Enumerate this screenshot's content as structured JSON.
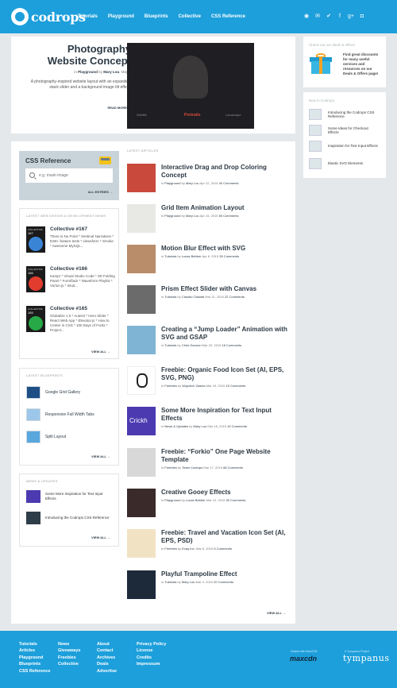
{
  "header": {
    "logo_text": "codrops",
    "nav": [
      "Tutorials",
      "Playground",
      "Blueprints",
      "Collective",
      "CSS Reference"
    ],
    "social_icons": [
      "rss-icon",
      "mail-icon",
      "twitter-icon",
      "facebook-icon",
      "google-plus-icon",
      "stumbleupon-icon"
    ],
    "social_glyphs": [
      "◉",
      "✉",
      "✔",
      "f",
      "g+",
      "◘"
    ]
  },
  "hero": {
    "title": "Photography Website Concept",
    "meta_in": "in",
    "meta_category": "Playground",
    "meta_by": "by",
    "meta_author": "Mary Lou",
    "meta_date": "May 6",
    "description": "A photography-inspired website layout with an expanding stack slider and a background image tilt effect.",
    "read_more": "READ MORE →",
    "image_labels": [
      "Wildlife",
      "Portraits",
      "Landscape"
    ]
  },
  "deals": {
    "heading": "Check out our deals & offers!",
    "text_prefix": "Find great discounts for many useful services and resources on our",
    "link": "Deals & Offers page!"
  },
  "new_in_codrops": {
    "heading": "New in Codrops",
    "items": [
      "Introducing the Codrops CSS Reference",
      "Some Ideas for Checkout Effects",
      "Inspiration for Text Input Effects",
      "Elastic SVG Elements"
    ]
  },
  "css_reference": {
    "title": "CSS Reference",
    "search_placeholder": "e.g. mask-image",
    "all_entries": "ALL ENTRIES →"
  },
  "collective": {
    "heading": "LATEST WEB DESIGN & DEVELOPMENT NEWS",
    "thumb_label": "COLLECTIVE",
    "items": [
      {
        "number": "167",
        "title": "Collective #167",
        "desc": "There is No Point * Sentinal Narratives * ES6+ feature tests * viewsform * Smoke * Awesome MySQL...",
        "color": "#3a84d6"
      },
      {
        "number": "166",
        "title": "Collective #166",
        "desc": "Kampr * Visual Studio Code * 3D Folding Panel * Formflack * Waveform Playlist * Vorlon.js * Intuit...",
        "color": "#e23c2f"
      },
      {
        "number": "165",
        "title": "Collective #165",
        "desc": "Globalize 1.0 * Auteist * Hero Slider * React Web App * Elevator.js * How to Center in CSS * 100 Days of Fonts * Project...",
        "color": "#27a947"
      }
    ],
    "view_all": "VIEW ALL →"
  },
  "blueprints": {
    "heading": "LATEST BLUEPRINTS",
    "items": [
      "Google Grid Gallery",
      "Responsive Full Width Tabs",
      "Split Layout"
    ],
    "view_all": "VIEW ALL →"
  },
  "news_updates": {
    "heading": "NEWS & UPDATES",
    "items": [
      "Some More Inspiration for Text Input Effects",
      "Introducing the Codrops CSS Reference"
    ],
    "view_all": "VIEW ALL →"
  },
  "articles": {
    "heading": "LATEST ARTICLES",
    "items": [
      {
        "title": "Interactive Drag and Drop Coloring Concept",
        "in": "in",
        "category": "Playground",
        "by": "by",
        "author": "Mary Lou",
        "date": "Apr 22, 2015",
        "comments": "40 Comments",
        "thumb_bg": "#c94a3c"
      },
      {
        "title": "Grid Item Animation Layout",
        "in": "in",
        "category": "Playground",
        "by": "by",
        "author": "Mary Lou",
        "date": "Apr 15, 2015",
        "comments": "50 Comments",
        "thumb_bg": "#e8e8e4"
      },
      {
        "title": "Motion Blur Effect with SVG",
        "in": "in",
        "category": "Tutorials",
        "by": "by",
        "author": "Lucas Bebber",
        "date": "Apr 8, 2015",
        "comments": "35 Comments",
        "thumb_bg": "#b98c6a"
      },
      {
        "title": "Prism Effect Slider with Canvas",
        "in": "in",
        "category": "Tutorials",
        "by": "by",
        "author": "Claudio Calautti",
        "date": "Mar 31, 2015",
        "comments": "22 Comments",
        "thumb_bg": "#6b6b6b"
      },
      {
        "title": "Creating a “Jump Loader” Animation with SVG and GSAP",
        "in": "in",
        "category": "Tutorials",
        "by": "by",
        "author": "Chris Gannon",
        "date": "Mar 25, 2015",
        "comments": "18 Comments",
        "thumb_bg": "#7fb4d4"
      },
      {
        "title": "Freebie: Organic Food Icon Set (AI, EPS, SVG, PNG)",
        "in": "in",
        "category": "Freebies",
        "by": "by",
        "author": "Wojciech Zasina",
        "date": "Mar 19, 2015",
        "comments": "15 Comments",
        "thumb_bg": "#ffffff"
      },
      {
        "title": "Some More Inspiration for Text Input Effects",
        "in": "in",
        "category": "News & Updates",
        "by": "by",
        "author": "Mary Lou",
        "date": "Mar 18, 2015",
        "comments": "19 Comments",
        "thumb_bg": "#4b3ab0"
      },
      {
        "title": "Freebie: “Forkio” One Page Website Template",
        "in": "in",
        "category": "Freebies",
        "by": "by",
        "author": "Team Codrops",
        "date": "Mar 17, 2015",
        "comments": "68 Comments",
        "thumb_bg": "#d8d8d8"
      },
      {
        "title": "Creative Gooey Effects",
        "in": "in",
        "category": "Playground",
        "by": "by",
        "author": "Lucas Bebber",
        "date": "Mar 10, 2015",
        "comments": "30 Comments",
        "thumb_bg": "#3a2a2a"
      },
      {
        "title": "Freebie: Travel and Vacation Icon Set (AI, EPS, PSD)",
        "in": "in",
        "category": "Freebies",
        "by": "by",
        "author": "Ecay Inc.",
        "date": "Mar 6, 2015",
        "comments": "5 Comments",
        "thumb_bg": "#f2e2c4"
      },
      {
        "title": "Playful Trampoline Effect",
        "in": "in",
        "category": "Tutorials",
        "by": "by",
        "author": "Mary Lou",
        "date": "Mar 4, 2015",
        "comments": "20 Comments",
        "thumb_bg": "#1d2a3a"
      }
    ],
    "thumb_text_crick": "Crickh",
    "view_all": "VIEW ALL →"
  },
  "footer": {
    "col1": [
      "Tutorials",
      "Articles",
      "Playground",
      "Blueprints",
      "CSS Reference"
    ],
    "col2": [
      "News",
      "Giveaways",
      "Freebies",
      "Collective"
    ],
    "col3": [
      "About",
      "Contact",
      "Archives",
      "Deals",
      "Advertise"
    ],
    "col4": [
      "Privacy Policy",
      "License",
      "Credits",
      "Impressum"
    ],
    "maxcdn_caption": "Hosted with MaxCDN",
    "maxcdn_logo": "maxcdn",
    "tympanus_caption": "A Tympanus Project",
    "tympanus_logo": "tympanus"
  }
}
